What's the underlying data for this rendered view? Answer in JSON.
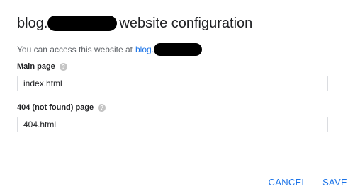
{
  "dialog": {
    "title_prefix": "blog.",
    "title_suffix": "website configuration",
    "access_text": "You can access this website at",
    "access_link": "blog."
  },
  "main_page": {
    "label": "Main page",
    "help": "?",
    "value": "index.html"
  },
  "not_found_page": {
    "label": "404 (not found) page",
    "help": "?",
    "value": "404.html"
  },
  "actions": {
    "cancel": "CANCEL",
    "save": "SAVE"
  },
  "colors": {
    "accent": "#1a73e8",
    "text": "#202124",
    "muted": "#5f6368"
  },
  "icons": {
    "help": "help-circle-icon"
  }
}
